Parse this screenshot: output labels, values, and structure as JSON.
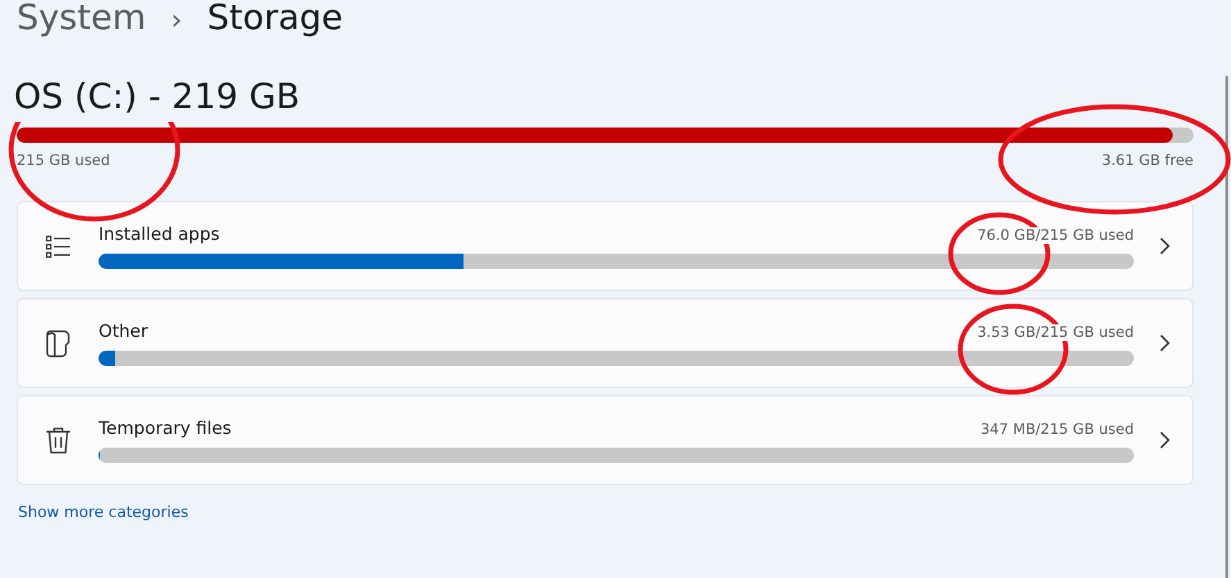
{
  "breadcrumb": {
    "parent": "System",
    "separator": "›",
    "current": "Storage"
  },
  "drive": {
    "title": "OS (C:) - 219 GB",
    "level": 0.982,
    "used": "215 GB used",
    "free": "3.61 GB free"
  },
  "categories": [
    {
      "kind": "apps",
      "label": "Installed apps",
      "usage": "76.0 GB/215 GB used",
      "level": 0.352
    },
    {
      "kind": "other",
      "label": "Other",
      "usage": "3.53 GB/215 GB used",
      "level": 0.016
    },
    {
      "kind": "temp",
      "label": "Temporary files",
      "usage": "347 MB/215 GB used",
      "level": 0.0016
    }
  ],
  "show_more_link": "Show more categories",
  "annotations": [
    {
      "kind": "circle"
    },
    {
      "kind": "circle"
    },
    {
      "kind": "circle"
    },
    {
      "kind": "circle"
    }
  ]
}
